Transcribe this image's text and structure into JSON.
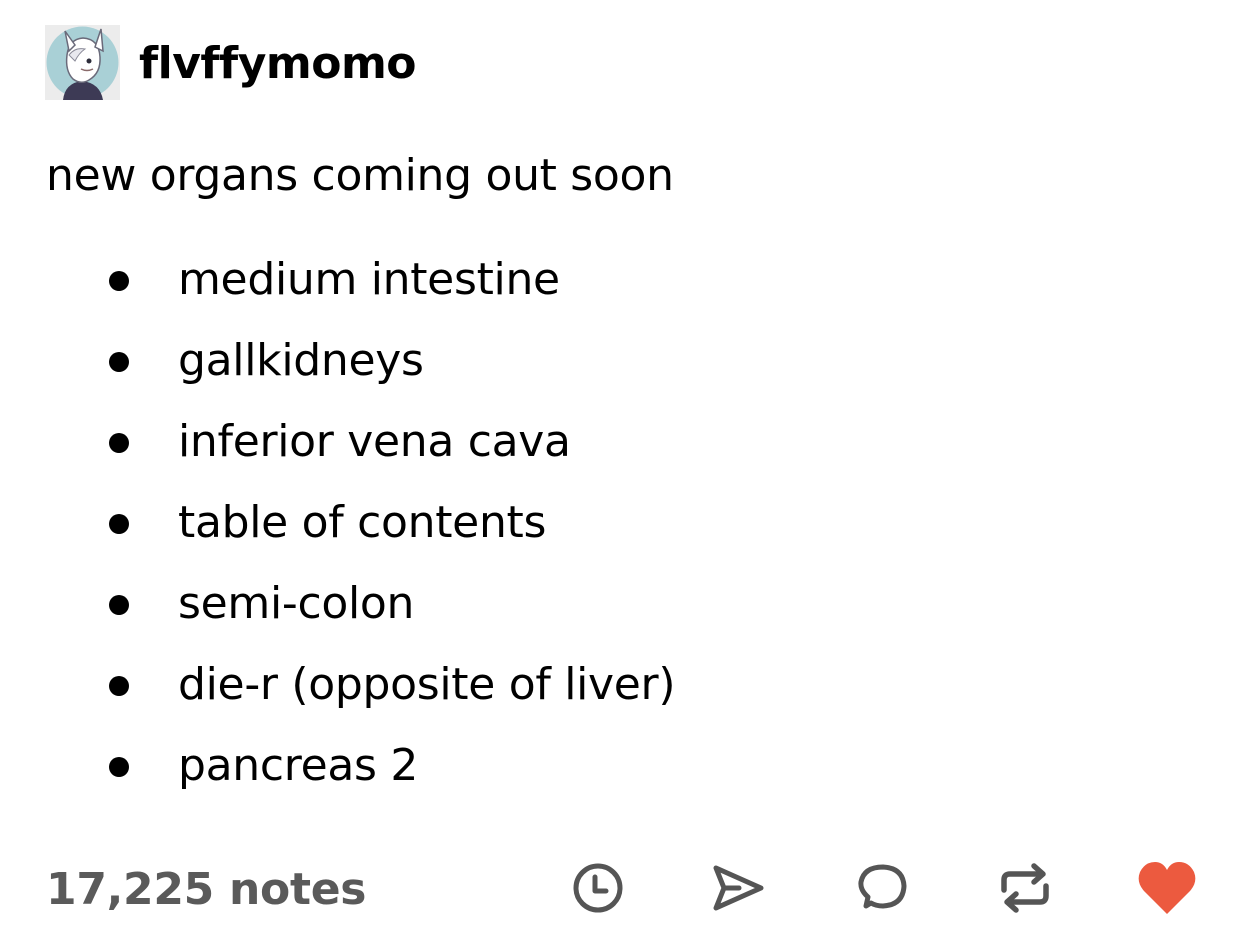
{
  "post": {
    "username": "flvffymomo",
    "avatar_icon": "avatar-character-icon",
    "text": "new organs coming out soon",
    "list_items": [
      "medium intestine",
      "gallkidneys",
      "inferior vena cava",
      "table of contents",
      "semi-colon",
      "die-r (opposite of liver)",
      "pancreas 2"
    ]
  },
  "footer": {
    "notes_label": "17,225 notes",
    "actions": [
      "clock-icon",
      "share-icon",
      "reply-icon",
      "reblog-icon",
      "like-heart-icon"
    ],
    "colors": {
      "icon": "#555555",
      "like": "#ec5a3f",
      "notes_text": "#5a5a5a"
    }
  }
}
